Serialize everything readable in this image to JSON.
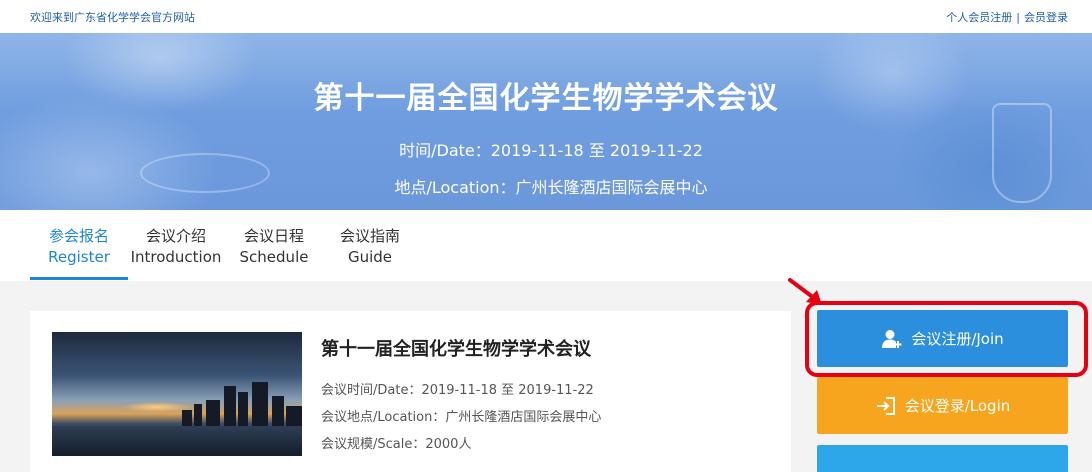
{
  "topbar": {
    "welcome": "欢迎来到广东省化学学会官方网站",
    "register_link": "个人会员注册",
    "separator": "|",
    "login_link": "会员登录"
  },
  "banner": {
    "title": "第十一届全国化学生物学学术会议",
    "date": "时间/Date：2019-11-18 至 2019-11-22",
    "location": "地点/Location：广州长隆酒店国际会展中心"
  },
  "tabs": [
    {
      "cn": "参会报名",
      "en": "Register",
      "active": true
    },
    {
      "cn": "会议介绍",
      "en": "Introduction",
      "active": false
    },
    {
      "cn": "会议日程",
      "en": "Schedule",
      "active": false
    },
    {
      "cn": "会议指南",
      "en": "Guide",
      "active": false
    }
  ],
  "card": {
    "title": "第十一届全国化学生物学学术会议",
    "date": "会议时间/Date：2019-11-18 至 2019-11-22",
    "location": "会议地点/Location：广州长隆酒店国际会展中心",
    "scale": "会议规模/Scale：2000人"
  },
  "actions": {
    "join_label": "会议注册/Join",
    "login_label": "会议登录/Login"
  },
  "colors": {
    "accent_blue": "#2b8fdd",
    "active_tab": "#1e86d6",
    "login_orange": "#f7a51e",
    "highlight_red": "#e60012",
    "link_blue": "#1e5fa8"
  },
  "icons": {
    "join": "user-plus-icon",
    "login": "sign-in-icon",
    "annotation": "arrow-icon"
  }
}
